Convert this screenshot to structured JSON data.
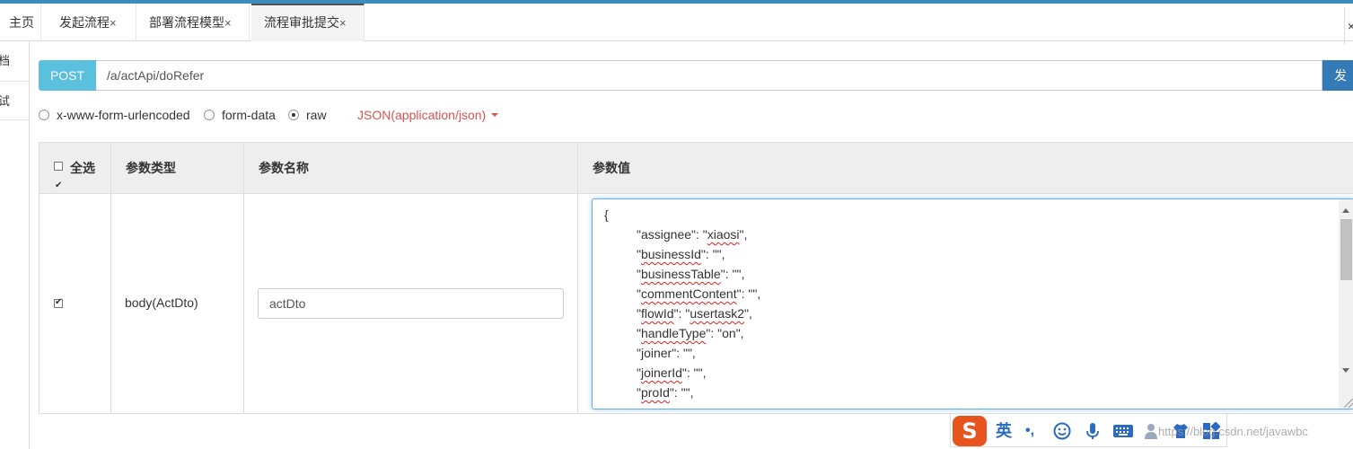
{
  "tabs": [
    {
      "label": "主页",
      "closable": false
    },
    {
      "label": "发起流程",
      "closable": true
    },
    {
      "label": "部署流程模型",
      "closable": true
    },
    {
      "label": "流程审批提交",
      "closable": true,
      "active": true
    }
  ],
  "tab_close_glyph": "×",
  "sidebar": {
    "items": [
      "档",
      "试"
    ]
  },
  "request": {
    "method": "POST",
    "url": "/a/actApi/doRefer",
    "send_label": "发送"
  },
  "body_modes": [
    {
      "label": "x-www-form-urlencoded",
      "selected": false
    },
    {
      "label": "form-data",
      "selected": false
    },
    {
      "label": "raw",
      "selected": true
    }
  ],
  "content_type": "JSON(application/json)",
  "table": {
    "headers": {
      "select_all": "全选",
      "param_type": "参数类型",
      "param_name": "参数名称",
      "param_value": "参数值"
    },
    "rows": [
      {
        "checked": true,
        "type": "body(ActDto)",
        "name": "actDto",
        "value_lines": [
          "{",
          "\"assignee\": \"xiaosi\",",
          "\"businessId\": \"\",",
          "\"businessTable\": \"\",",
          "\"commentContent\": \"\",",
          "\"flowId\": \"usertask2\",",
          "\"handleType\": \"on\",",
          "\"joiner\": \"\",",
          "\"joinerId\": \"\",",
          "\"proId\": \"\","
        ]
      }
    ]
  },
  "ime": {
    "mode_label": "英",
    "punct": "•,"
  },
  "watermark": "https://blog.csdn.net/javawbc",
  "colors": {
    "method": "#5bc0de",
    "send": "#337ab7",
    "content_type": "#d9534f",
    "topbar": "#3c8dbc"
  }
}
